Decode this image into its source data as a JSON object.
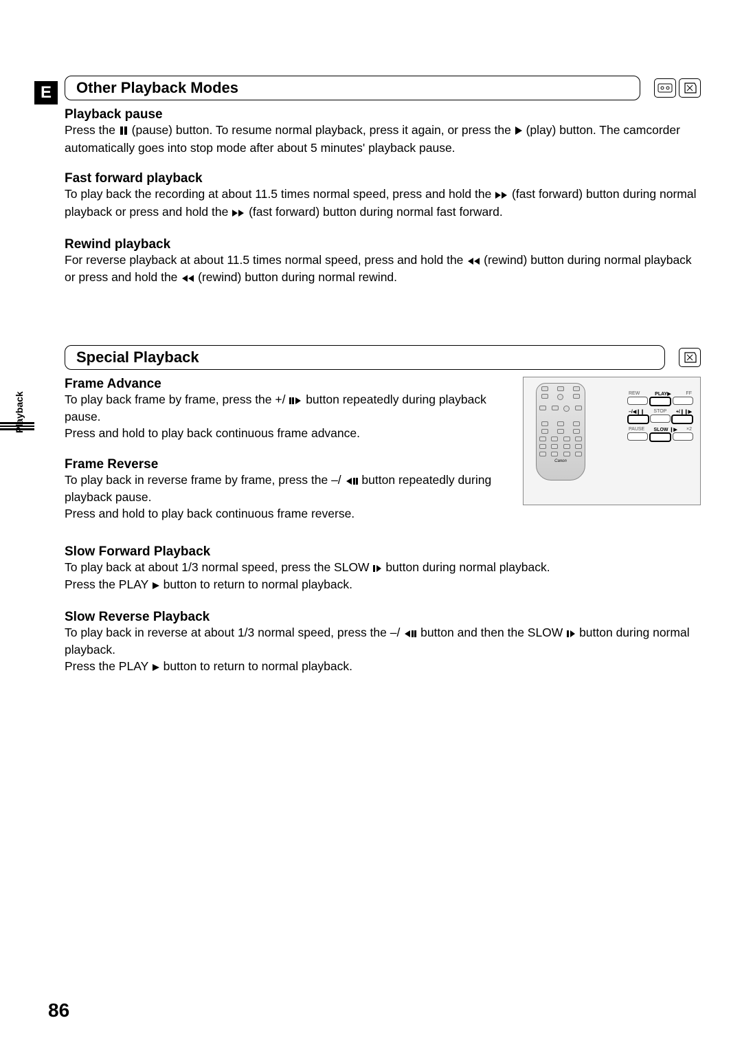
{
  "language_tab": "E",
  "side_tab": "Playback",
  "page_number": "86",
  "sections": [
    {
      "title": "Other Playback Modes",
      "subsections": {
        "playback_pause": {
          "heading": "Playback pause",
          "text_a": "Press the ",
          "text_b": " (pause) button. To resume normal playback, press it again, or press the ",
          "text_c": " (play) button. The camcorder automatically goes into stop mode after about 5 minutes' playback pause."
        },
        "fast_forward": {
          "heading": "Fast forward playback",
          "text_a": "To play back the recording at about 11.5 times normal speed, press and hold the ",
          "text_b": " (fast forward) button during normal playback or press and hold the ",
          "text_c": " (fast forward) button during normal fast forward."
        },
        "rewind": {
          "heading": "Rewind playback",
          "text_a": "For reverse playback at about 11.5 times normal speed, press and hold the ",
          "text_b": " (rewind) button during normal playback or press and hold the ",
          "text_c": " (rewind) button during normal rewind."
        }
      }
    },
    {
      "title": "Special Playback",
      "subsections": {
        "frame_advance": {
          "heading": "Frame Advance",
          "text_a": "To play back frame by frame, press the +/ ",
          "text_b": " button repeatedly during playback pause.",
          "text_c": "Press and hold to play back continuous frame advance."
        },
        "frame_reverse": {
          "heading": "Frame Reverse",
          "text_a": "To play back in reverse frame by frame, press the –/",
          "text_b": " button repeatedly during playback pause.",
          "text_c": "Press and hold to play back continuous frame reverse."
        },
        "slow_forward": {
          "heading": "Slow Forward Playback",
          "text_a": "To play back at about 1/3 normal speed, press the SLOW ",
          "text_b": " button during normal playback.",
          "text_c": "Press the PLAY ",
          "text_d": " button to return to normal playback."
        },
        "slow_reverse": {
          "heading": "Slow Reverse Playback",
          "text_a": "To play back in reverse at about 1/3 normal speed, press the –/",
          "text_b": " button and then the SLOW ",
          "text_c": " button during normal playback.",
          "text_d": "Press the PLAY ",
          "text_e": " button to return to normal playback."
        }
      }
    }
  ],
  "remote_labels": {
    "row1": [
      "REW",
      "PLAY",
      "FF"
    ],
    "row2": [
      "–/",
      "STOP",
      "+/"
    ],
    "row3": [
      "PAUSE",
      "SLOW",
      "×2"
    ],
    "brand": "Canon"
  }
}
